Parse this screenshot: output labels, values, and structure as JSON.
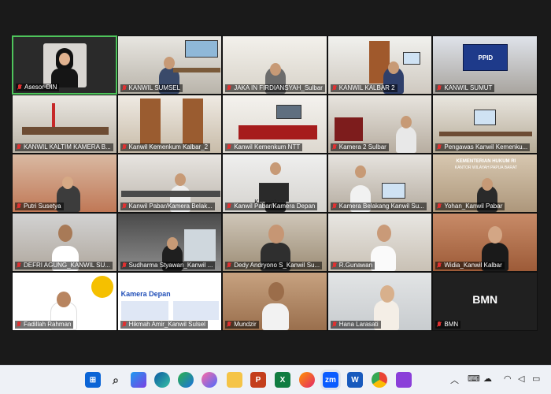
{
  "participants": [
    {
      "name": "Asesor-DIN"
    },
    {
      "name": "KANWIL SUMSEL"
    },
    {
      "name": "JAKA IN FIRDIANSYAH_Sulbar"
    },
    {
      "name": "KANWIL KALBAR 2"
    },
    {
      "name": "KANWIL SUMUT"
    },
    {
      "name": "KANWIL KALTIM KAMERA B..."
    },
    {
      "name": "Kanwil Kemenkum Kalbar_2"
    },
    {
      "name": "Kanwil Kemenkum NTT"
    },
    {
      "name": "Kamera 2 Sulbar"
    },
    {
      "name": "Pengawas Kanwil Kemenku..."
    },
    {
      "name": "Putri Susetya"
    },
    {
      "name": "Kanwil Pabar/Kamera Belak..."
    },
    {
      "name": "Kanwil Pabar/Kamera Depan"
    },
    {
      "name": "Kamera Belakang Kanwil Su..."
    },
    {
      "name": "Yohan_Kanwil Pabar"
    },
    {
      "name": "DEFRI AGUNG_KANWIL SU..."
    },
    {
      "name": "Sudharma Styawan_Kanwil ..."
    },
    {
      "name": "Dedy Andryono S_Kanwil Su..."
    },
    {
      "name": "R.Gunawan"
    },
    {
      "name": "Widia_Kanwil Kalbar"
    },
    {
      "name": "Fadillah Rahman"
    },
    {
      "name": "Hikmah Amir_Kanwil Sulsel"
    },
    {
      "name": "Mundzir"
    },
    {
      "name": "Hana Larasati"
    },
    {
      "name": "BMN"
    }
  ],
  "bmn_text": "BMN",
  "slide_text": "Kamera Depan",
  "wall_text": "KEMENTERIAN HUKUM RI",
  "wall_text2": "KANTOR WILAYAH PAPUA BARAT",
  "tv_text": "PPID",
  "kemenkum_text": "Kemenkum",
  "taskbar": {
    "apps": [
      "start-icon",
      "search-icon",
      "copilot-icon",
      "edge-icon",
      "canary-icon",
      "copilot-app-icon",
      "file-explorer-icon",
      "powerpoint-icon",
      "excel-icon",
      "firefox-icon",
      "zoom-icon",
      "word-icon",
      "chrome-icon",
      "pixel-app-icon"
    ]
  },
  "colors": {
    "active_border": "#4ec45b",
    "muted_mic": "#e03131",
    "background": "#1a1a1a"
  }
}
